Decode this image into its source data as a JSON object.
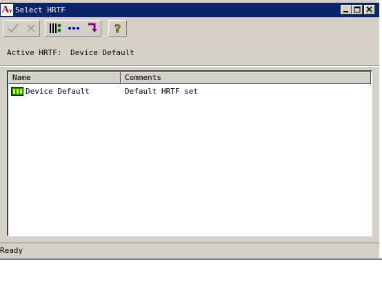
{
  "window": {
    "title": "Select HRTF",
    "icon_label": "A",
    "buttons": {
      "minimize_icon": "minimize-icon",
      "maximize_icon": "maximize-icon",
      "close_icon": "close-icon"
    }
  },
  "toolbar": {
    "icons": [
      "checkmark-icon",
      "x-icon",
      "properties-icon",
      "more-icon",
      "return-arrow-icon",
      "help-icon"
    ],
    "ok_glyph": "✓",
    "cancel_glyph": "✕",
    "more_glyph": "•••",
    "help_glyph": "?"
  },
  "active": {
    "label": "Active HRTF:",
    "value": "Device Default"
  },
  "list": {
    "columns": [
      "Name",
      "Comments"
    ],
    "rows": [
      {
        "name": "Device Default",
        "comment": "Default HRTF set",
        "icon": "hrtf-device-icon"
      }
    ]
  },
  "status": {
    "text": "Ready"
  },
  "colors": {
    "titlebar": "#0a246a",
    "face": "#d4d0c8",
    "toolbar_purple": "#800080",
    "toolbar_blue": "#0000a0"
  }
}
